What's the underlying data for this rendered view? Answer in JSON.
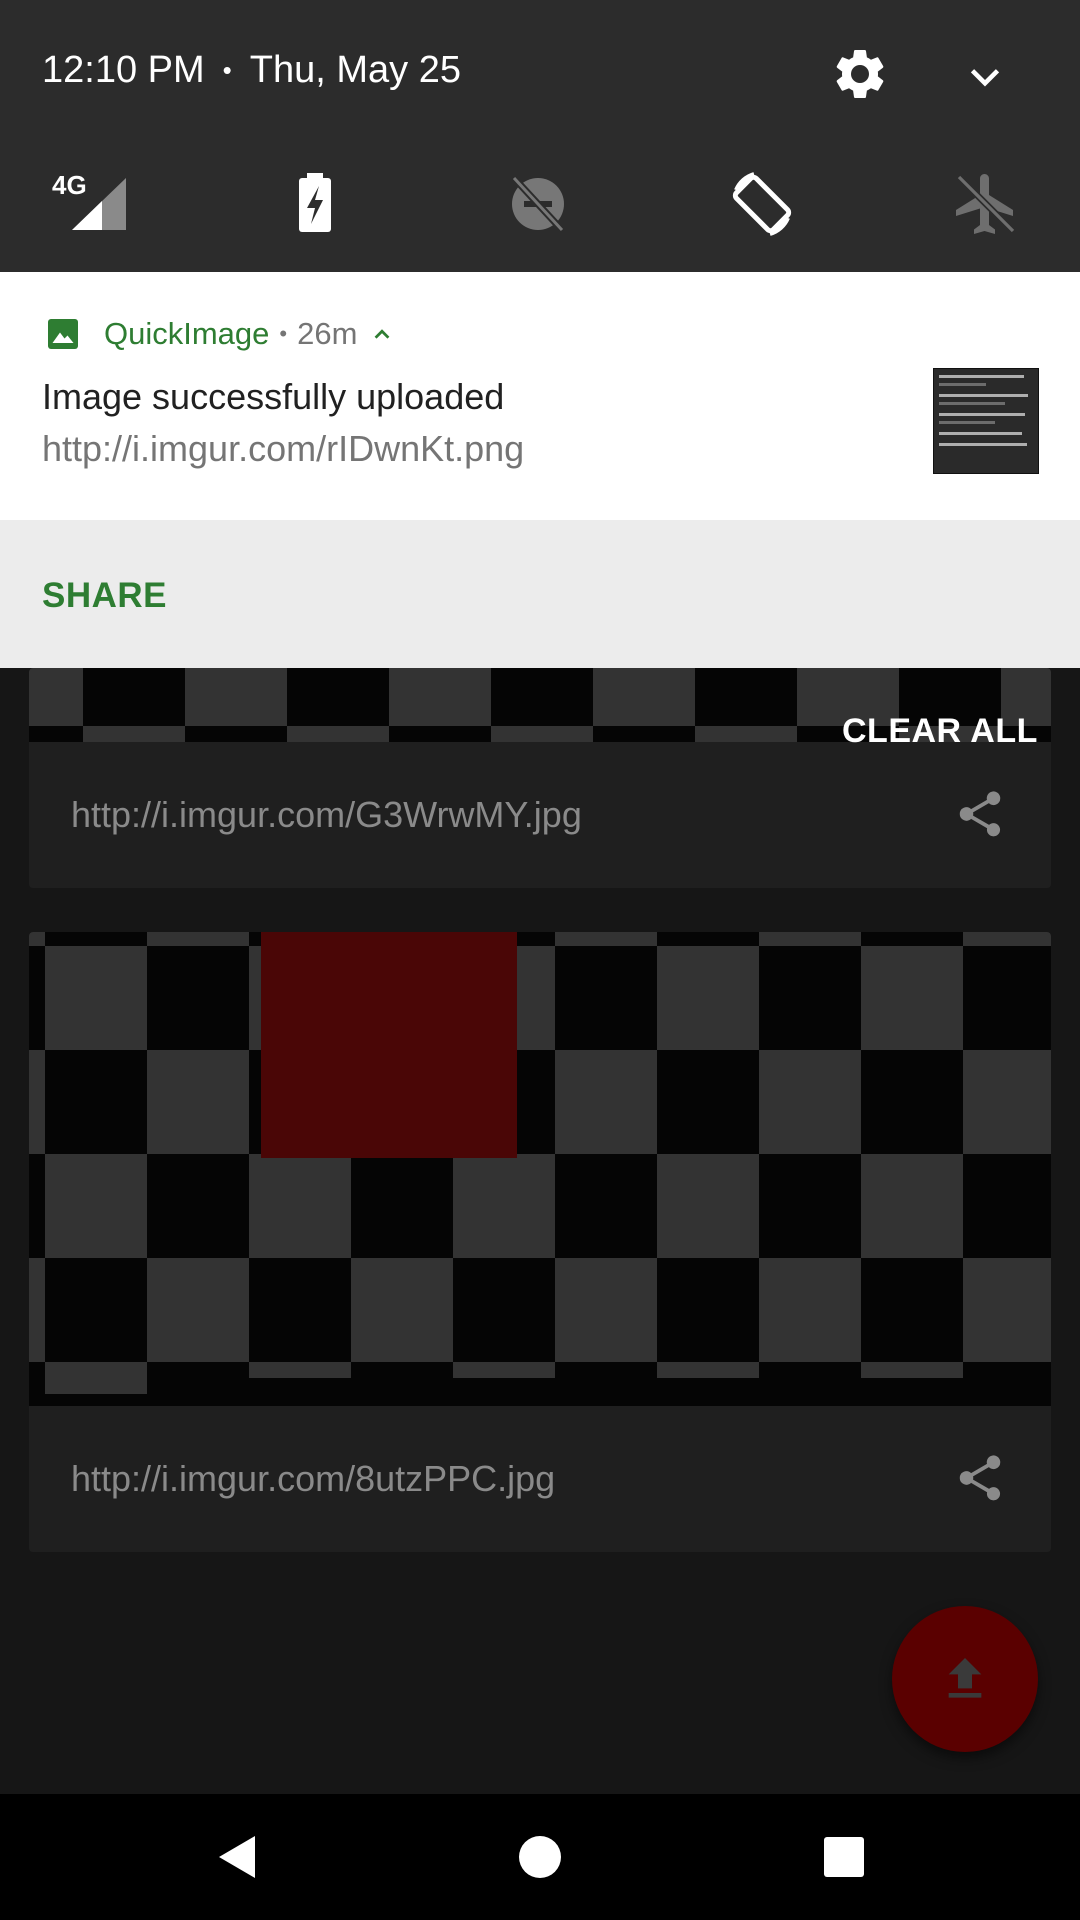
{
  "status": {
    "time": "12:10 PM",
    "separator": "•",
    "date": "Thu, May 25",
    "network_label": "4G"
  },
  "notification": {
    "app_name": "QuickImage",
    "separator": "•",
    "age": "26m",
    "title": "Image successfully uploaded",
    "url": "http://i.imgur.com/rIDwnKt.png",
    "action_share": "SHARE"
  },
  "app": {
    "clear_all": "CLEAR ALL",
    "items": [
      {
        "url": "http://i.imgur.com/G3WrwMY.jpg"
      },
      {
        "url": "http://i.imgur.com/8utzPPC.jpg"
      }
    ]
  },
  "icons": {
    "settings": "gear-icon",
    "expand": "chevron-down-icon",
    "signal": "cellular-signal-icon",
    "battery_saver": "battery-charging-icon",
    "dnd": "do-not-disturb-off-icon",
    "auto_rotate": "screen-rotation-icon",
    "airplane": "airplane-mode-off-icon",
    "app": "image-icon",
    "share": "share-icon",
    "upload": "upload-icon",
    "back": "back-icon",
    "home": "home-icon",
    "recents": "recents-icon"
  },
  "colors": {
    "accent": "#2e7d32",
    "fab": "#5a0000",
    "red_block": "#4a0606"
  }
}
